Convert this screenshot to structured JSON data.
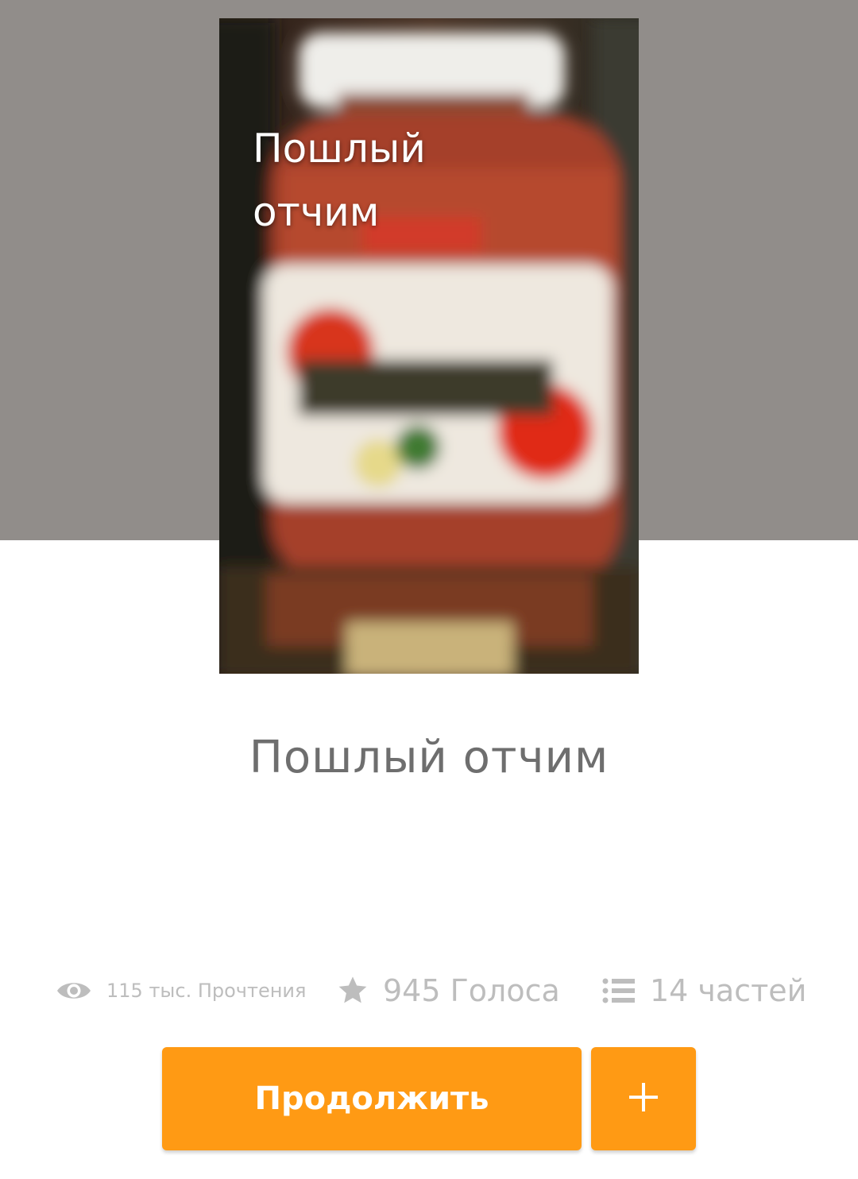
{
  "cover": {
    "title": "Пошлый отчим"
  },
  "story": {
    "title": "Пошлый отчим"
  },
  "stats": {
    "reads": "115 тыс. Прочтения",
    "votes": "945 Голоса",
    "parts": "14 частей"
  },
  "actions": {
    "continue_label": "Продолжить"
  },
  "colors": {
    "accent": "#ff9a14",
    "header_bg": "#918d8a",
    "stat_text": "#bdbdbd",
    "title_text": "#6e6e6e"
  }
}
